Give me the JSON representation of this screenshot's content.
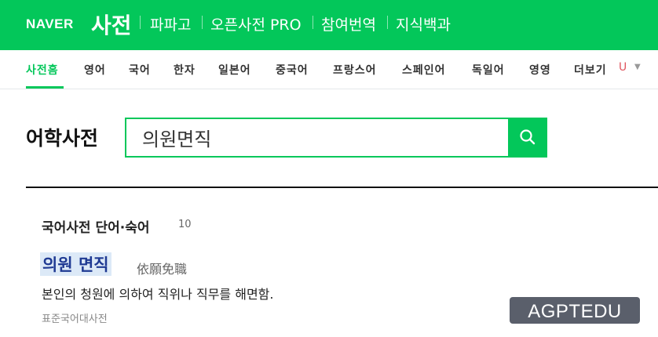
{
  "header": {
    "logo": "NAVER",
    "title": "사전",
    "services": [
      "파파고",
      "오픈사전 PRO",
      "참여번역",
      "지식백과"
    ]
  },
  "nav": {
    "items": [
      "사전홈",
      "영어",
      "국어",
      "한자",
      "일본어",
      "중국어",
      "프랑스어",
      "스페인어",
      "독일어",
      "영영",
      "더보기"
    ],
    "active_index": 0,
    "badge": "U"
  },
  "search": {
    "section_title": "어학사전",
    "query": "의원면직"
  },
  "results": {
    "section_label": "국어사전 단어·숙어",
    "count": "10",
    "entries": [
      {
        "word": "의원 면직",
        "hanja": "依願免職",
        "definition": "본인의 청원에 의하여 직위나 직무를 해면함.",
        "source": "표준국어대사전"
      }
    ]
  },
  "watermark": "AGPTEDU",
  "colors": {
    "brand": "#03c75a",
    "highlight": "#dce9f7",
    "link": "#1f3a93"
  }
}
